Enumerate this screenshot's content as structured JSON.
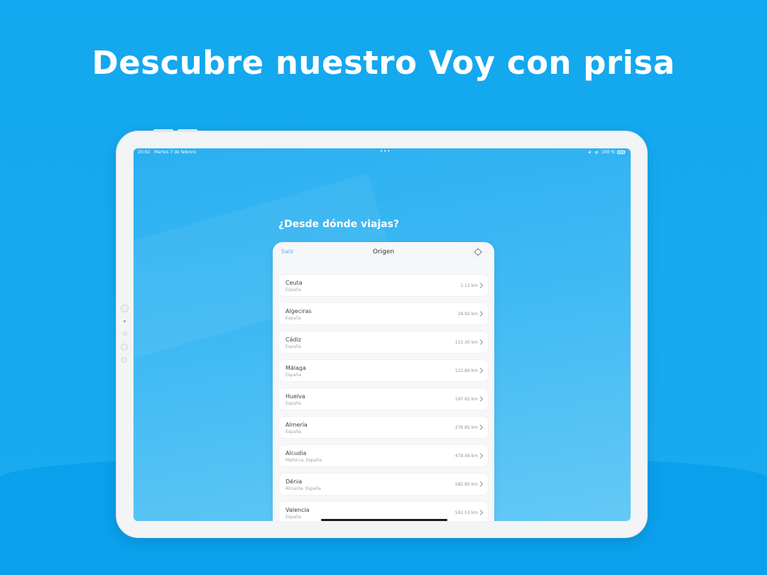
{
  "headline": "Descubre nuestro Voy con prisa",
  "status_bar": {
    "time": "20:02",
    "date": "Martes 7 de febrero",
    "dots": "•••",
    "battery": "100 %"
  },
  "question": "¿Desde dónde viajas?",
  "sheet": {
    "exit_label": "Salir",
    "title": "Origen",
    "locate_icon": "crosshair-icon"
  },
  "origins": [
    {
      "name": "Ceuta",
      "region": "España",
      "distance": "2.12 km"
    },
    {
      "name": "Algeciras",
      "region": "España",
      "distance": "28.92 km"
    },
    {
      "name": "Cádiz",
      "region": "España",
      "distance": "111.30 km"
    },
    {
      "name": "Málaga",
      "region": "España",
      "distance": "122.89 km"
    },
    {
      "name": "Huelva",
      "region": "España",
      "distance": "197.62 km"
    },
    {
      "name": "Almería",
      "region": "España",
      "distance": "276.85 km"
    },
    {
      "name": "Alcudia",
      "region": "Mallorca, España",
      "distance": "479.49 km"
    },
    {
      "name": "Dénia",
      "region": "Alicante, España",
      "distance": "582.85 km"
    },
    {
      "name": "Valencia",
      "region": "España",
      "distance": "592.53 km"
    }
  ],
  "colors": {
    "background": "#13a8ef",
    "accent": "#5bb3e8",
    "screen": "#3fb9f3"
  }
}
